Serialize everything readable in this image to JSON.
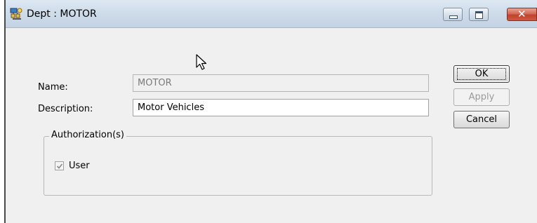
{
  "window": {
    "title": "Dept : MOTOR",
    "icon": "department-icon",
    "controls": {
      "minimize": "minimize-icon",
      "maximize": "maximize-icon",
      "close": "close-icon",
      "close_glyph": "✕"
    }
  },
  "form": {
    "name_label": "Name:",
    "name_value": "MOTOR",
    "description_label": "Description:",
    "description_value": "Motor Vehicles"
  },
  "authorizations": {
    "legend": "Authorization(s)",
    "items": [
      {
        "label": "User",
        "checked": true,
        "enabled": false
      }
    ]
  },
  "buttons": {
    "ok": "OK",
    "apply": "Apply",
    "cancel": "Cancel"
  },
  "colors": {
    "window_bg": "#f0f0f0",
    "titlebar": "#cfdcea",
    "close_button": "#c0432d"
  }
}
